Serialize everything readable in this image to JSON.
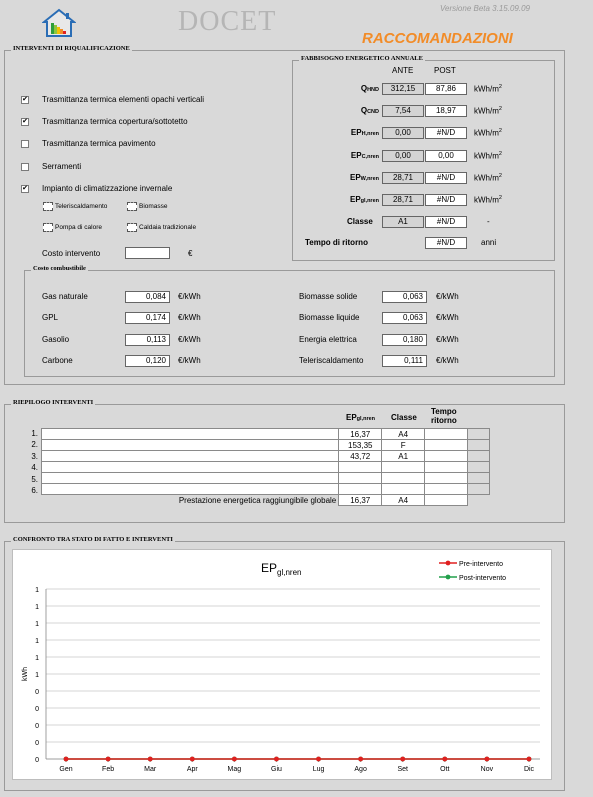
{
  "header": {
    "app_title": "DOCET",
    "version": "Versione Beta 3.15.09.09",
    "section_title": "RACCOMANDAZIONI",
    "logo_icon": "house-energy-icon"
  },
  "interventi": {
    "legend": "INTERVENTI DI RIQUALIFICAZIONE",
    "items": [
      {
        "label": "Trasmittanza termica elementi opachi verticali",
        "checked": true
      },
      {
        "label": "Trasmittanza termica copertura/sottotetto",
        "checked": true
      },
      {
        "label": "Trasmittanza termica pavimento",
        "checked": false
      },
      {
        "label": "Serramenti",
        "checked": false
      },
      {
        "label": "Impianto di climatizzazione invernale",
        "checked": true
      }
    ],
    "impianti": [
      "Teleriscaldamento",
      "Biomasse",
      "Pompa di calore",
      "Caldaia tradizionale"
    ],
    "costo_label": "Costo intervento",
    "costo_value": "",
    "costo_unit": "€"
  },
  "fabbisogno": {
    "legend": "FABBISOGNO ENERGETICO ANNUALE",
    "col_ante": "ANTE",
    "col_post": "POST",
    "rows": [
      {
        "label_main": "Q",
        "label_sub": "HND",
        "ante": "312,15",
        "post": "87,86",
        "unit_main": "kWh/m",
        "unit_sup": "2"
      },
      {
        "label_main": "Q",
        "label_sub": "CND",
        "ante": "7,54",
        "post": "18,97",
        "unit_main": "kWh/m",
        "unit_sup": "2"
      },
      {
        "label_main": "EP",
        "label_sub": "H,nren",
        "ante": "0,00",
        "post": "#N/D",
        "unit_main": "kWh/m",
        "unit_sup": "2"
      },
      {
        "label_main": "EP",
        "label_sub": "C,nren",
        "ante": "0,00",
        "post": "0,00",
        "unit_main": "kWh/m",
        "unit_sup": "2"
      },
      {
        "label_main": "EP",
        "label_sub": "W,nren",
        "ante": "28,71",
        "post": "#N/D",
        "unit_main": "kWh/m",
        "unit_sup": "2"
      },
      {
        "label_main": "EP",
        "label_sub": "gl,nren",
        "ante": "28,71",
        "post": "#N/D",
        "unit_main": "kWh/m",
        "unit_sup": "2"
      }
    ],
    "classe_label": "Classe",
    "classe_ante": "A1",
    "classe_post": "#N/D",
    "classe_unit": "-",
    "tempo_label": "Tempo di ritorno",
    "tempo_post": "#N/D",
    "tempo_unit": "anni"
  },
  "combustibile": {
    "legend": "Costo combustibile",
    "left": [
      {
        "label": "Gas naturale",
        "value": "0,084",
        "unit": "€/kWh"
      },
      {
        "label": "GPL",
        "value": "0,174",
        "unit": "€/kWh"
      },
      {
        "label": "Gasolio",
        "value": "0,113",
        "unit": "€/kWh"
      },
      {
        "label": "Carbone",
        "value": "0,120",
        "unit": "€/kWh"
      }
    ],
    "right": [
      {
        "label": "Biomasse solide",
        "value": "0,063",
        "unit": "€/kWh"
      },
      {
        "label": "Biomasse liquide",
        "value": "0,063",
        "unit": "€/kWh"
      },
      {
        "label": "Energia elettrica",
        "value": "0,180",
        "unit": "€/kWh"
      },
      {
        "label": "Teleriscaldamento",
        "value": "0,111",
        "unit": "€/kWh"
      }
    ]
  },
  "riepilogo": {
    "legend": "RIEPILOGO INTERVENTI",
    "col_ep_main": "EP",
    "col_ep_sub": "gl,nren",
    "col_classe": "Classe",
    "col_tempo": "Tempo ritorno",
    "rows": [
      {
        "num": "1.",
        "name": "",
        "ep": "16,37",
        "classe": "A4",
        "tempo": ""
      },
      {
        "num": "2.",
        "name": "",
        "ep": "153,35",
        "classe": "F",
        "tempo": ""
      },
      {
        "num": "3.",
        "name": "",
        "ep": "43,72",
        "classe": "A1",
        "tempo": ""
      },
      {
        "num": "4.",
        "name": "",
        "ep": "",
        "classe": "",
        "tempo": ""
      },
      {
        "num": "5.",
        "name": "",
        "ep": "",
        "classe": "",
        "tempo": ""
      },
      {
        "num": "6.",
        "name": "",
        "ep": "",
        "classe": "",
        "tempo": ""
      }
    ],
    "total_label": "Prestazione energetica raggiungibile globale",
    "total_ep": "16,37",
    "total_classe": "A4"
  },
  "confronto": {
    "legend": "CONFRONTO TRA STATO DI FATTO E INTERVENTI"
  },
  "chart_data": {
    "type": "line",
    "title_main": "EP",
    "title_sub": "gl,nren",
    "ylabel": "kWh",
    "categories": [
      "Gen",
      "Feb",
      "Mar",
      "Apr",
      "Mag",
      "Giu",
      "Lug",
      "Ago",
      "Set",
      "Ott",
      "Nov",
      "Dic"
    ],
    "y_tick_labels": [
      "1",
      "1",
      "1",
      "1",
      "1",
      "1",
      "0",
      "0",
      "0",
      "0",
      "0"
    ],
    "ylim": [
      0,
      1
    ],
    "grid": true,
    "legend_position": "top-right",
    "series": [
      {
        "name": "Pre-intervento",
        "color": "#e02020",
        "values": [
          0,
          0,
          0,
          0,
          0,
          0,
          0,
          0,
          0,
          0,
          0,
          0
        ]
      },
      {
        "name": "Post-intervento",
        "color": "#22a04b",
        "values": [
          0,
          0,
          0,
          0,
          0,
          0,
          0,
          0,
          0,
          0,
          0,
          0
        ]
      }
    ]
  }
}
